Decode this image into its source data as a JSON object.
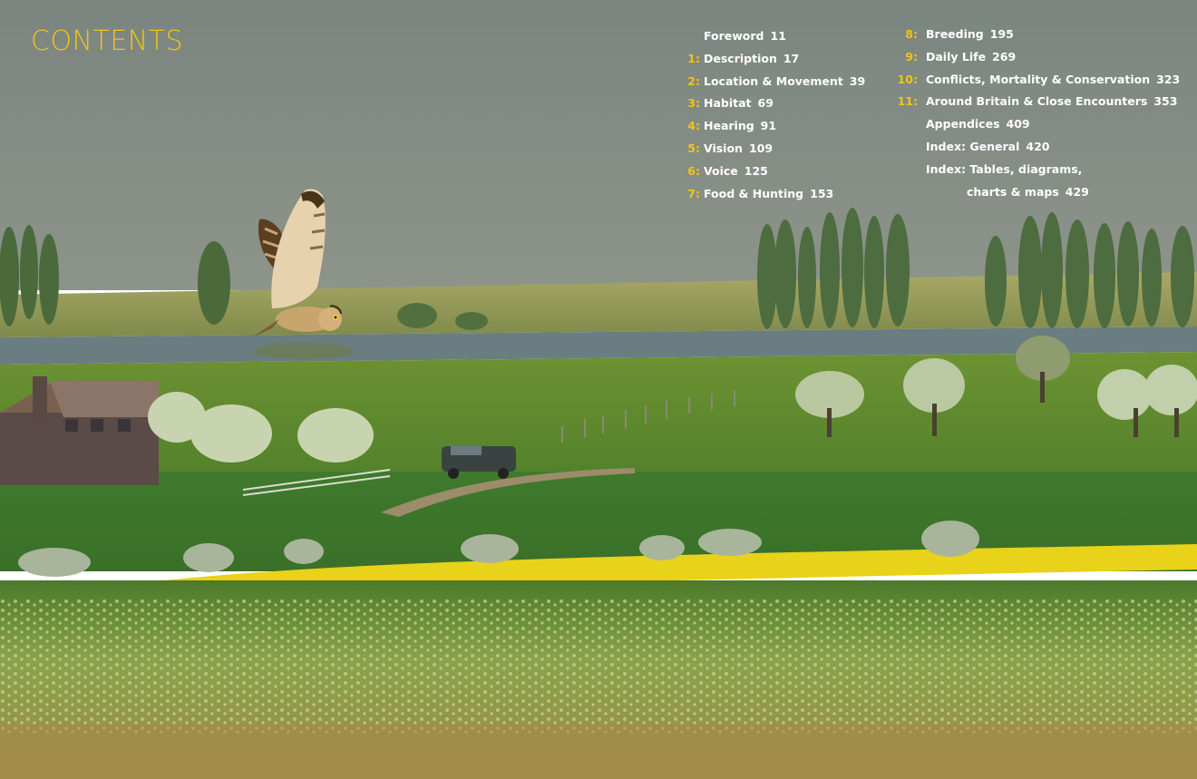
{
  "heading": "CONTENTS",
  "toc_column_1": [
    {
      "num": "",
      "title": "Foreword",
      "page": "11"
    },
    {
      "num": "1:",
      "title": "Description",
      "page": "17"
    },
    {
      "num": "2:",
      "title": "Location & Movement",
      "page": "39"
    },
    {
      "num": "3:",
      "title": "Habitat",
      "page": "69"
    },
    {
      "num": "4:",
      "title": "Hearing",
      "page": "91"
    },
    {
      "num": "5:",
      "title": "Vision",
      "page": "109"
    },
    {
      "num": "6:",
      "title": "Voice",
      "page": "125"
    },
    {
      "num": "7:",
      "title": "Food & Hunting",
      "page": "153"
    }
  ],
  "toc_column_2": [
    {
      "num": "8:",
      "title": "Breeding",
      "page": "195"
    },
    {
      "num": "9:",
      "title": "Daily Life",
      "page": "269"
    },
    {
      "num": "10:",
      "title": "Conflicts, Mortality & Conservation",
      "page": "323"
    },
    {
      "num": "11:",
      "title": "Around Britain & Close Encounters",
      "page": "353"
    },
    {
      "num": "",
      "title": "Appendices",
      "page": "409"
    },
    {
      "num": "",
      "title": "Index: General",
      "page": "420"
    },
    {
      "num": "",
      "title": "Index: Tables, diagrams,",
      "page": ""
    },
    {
      "num": "",
      "title": "charts & maps",
      "page": "429"
    }
  ],
  "colors": {
    "accent": "#f0c419",
    "sky": "#7f8a85",
    "field_green": "#5f8a2c",
    "rapeseed_yellow": "#e8d21a"
  },
  "photo_subject": "owl-in-flight-over-farmland"
}
